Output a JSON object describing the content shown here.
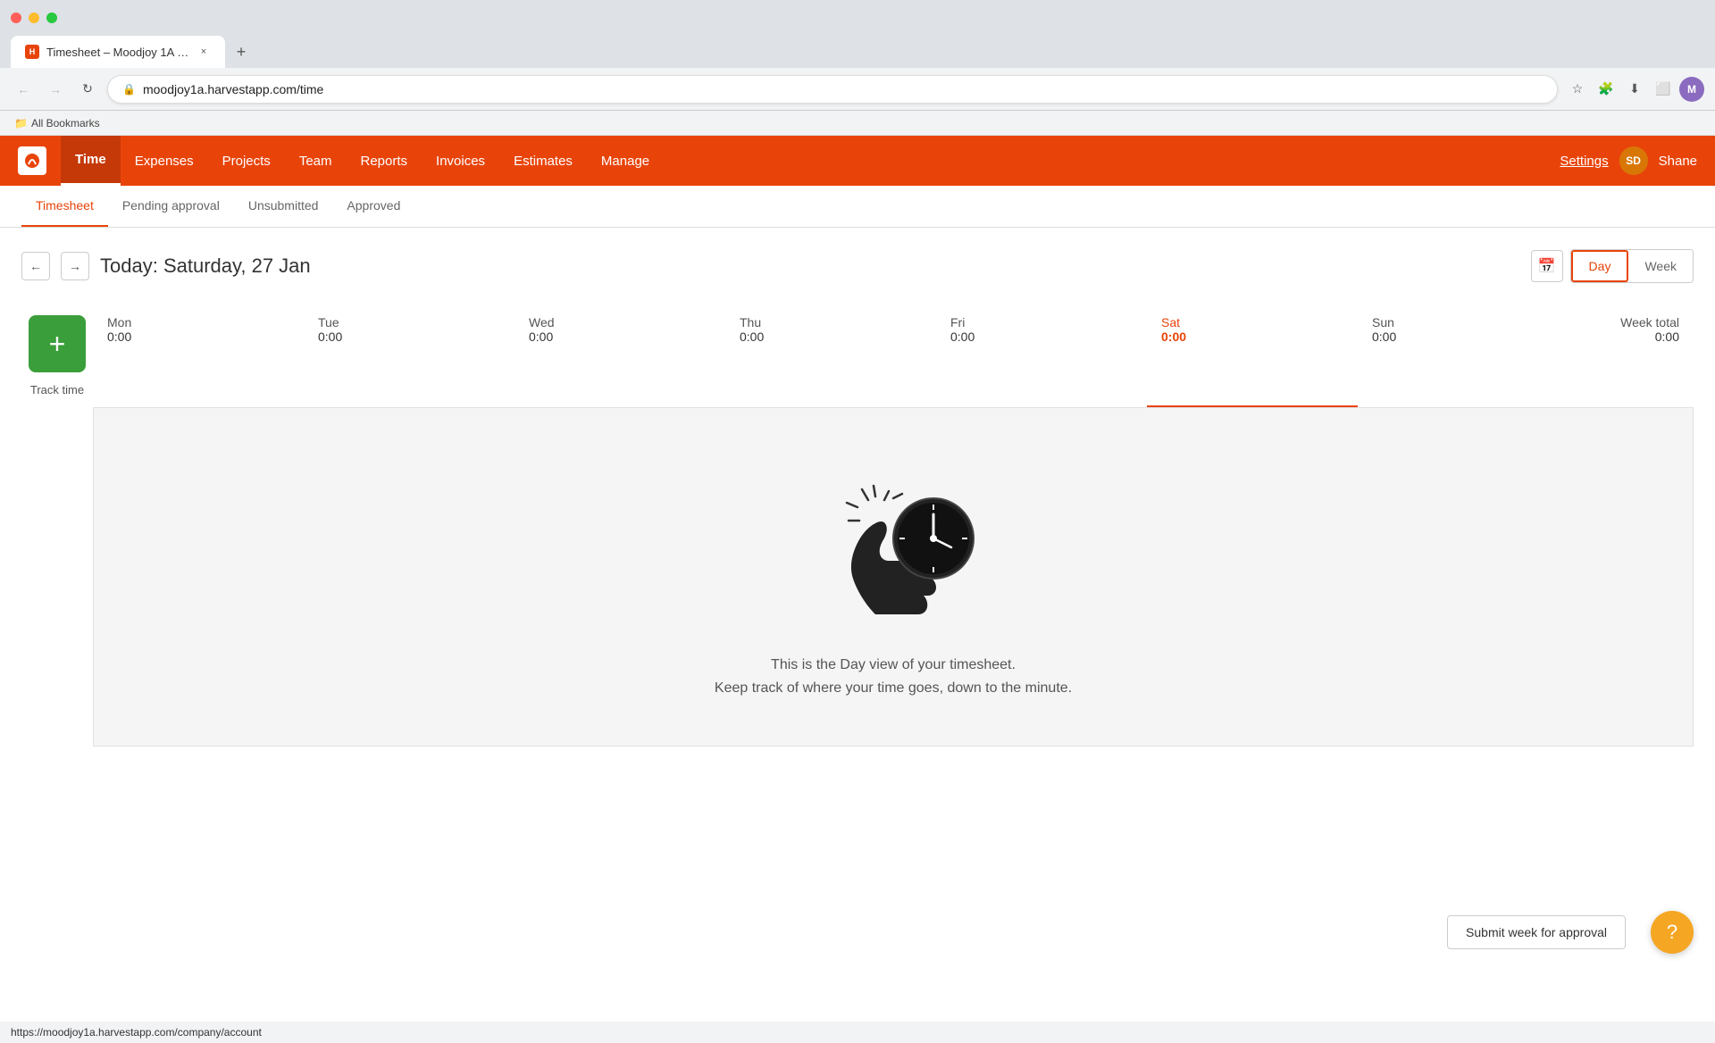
{
  "browser": {
    "tab": {
      "favicon": "H",
      "title": "Timesheet – Moodjoy 1A – Ha…",
      "close_label": "×"
    },
    "new_tab_label": "+",
    "toolbar": {
      "back_label": "←",
      "forward_label": "→",
      "refresh_label": "↻",
      "url": "moodjoy1a.harvestapp.com/time",
      "bookmark_label": "☆",
      "extensions_label": "🧩",
      "download_label": "⬇",
      "cast_label": "⬜",
      "profile_label": "M"
    },
    "bookmarks": {
      "label": "All Bookmarks"
    }
  },
  "nav": {
    "items": [
      {
        "id": "time",
        "label": "Time",
        "active": true
      },
      {
        "id": "expenses",
        "label": "Expenses"
      },
      {
        "id": "projects",
        "label": "Projects"
      },
      {
        "id": "team",
        "label": "Team"
      },
      {
        "id": "reports",
        "label": "Reports"
      },
      {
        "id": "invoices",
        "label": "Invoices"
      },
      {
        "id": "estimates",
        "label": "Estimates"
      },
      {
        "id": "manage",
        "label": "Manage"
      }
    ],
    "settings_label": "Settings",
    "user_initials": "SD",
    "user_name": "Shane"
  },
  "sub_nav": {
    "items": [
      {
        "id": "timesheet",
        "label": "Timesheet",
        "active": true
      },
      {
        "id": "pending",
        "label": "Pending approval"
      },
      {
        "id": "unsubmitted",
        "label": "Unsubmitted"
      },
      {
        "id": "approved",
        "label": "Approved"
      }
    ]
  },
  "date_nav": {
    "prev_label": "←",
    "next_label": "→",
    "today_prefix": "Today: ",
    "date": "Saturday, 27 Jan",
    "calendar_icon": "📅",
    "view_day": "Day",
    "view_week": "Week"
  },
  "week": {
    "track_time_label": "Track time",
    "plus_label": "+",
    "days": [
      {
        "name": "Mon",
        "hours": "0:00",
        "active": false
      },
      {
        "name": "Tue",
        "hours": "0:00",
        "active": false
      },
      {
        "name": "Wed",
        "hours": "0:00",
        "active": false
      },
      {
        "name": "Thu",
        "hours": "0:00",
        "active": false
      },
      {
        "name": "Fri",
        "hours": "0:00",
        "active": false
      },
      {
        "name": "Sat",
        "hours": "0:00",
        "active": true
      },
      {
        "name": "Sun",
        "hours": "0:00",
        "active": false
      }
    ],
    "total_label": "Week total",
    "total_hours": "0:00"
  },
  "empty_state": {
    "line1": "This is the Day view of your timesheet.",
    "line2": "Keep track of where your time goes, down to the minute."
  },
  "bottom": {
    "submit_label": "Submit week for approval",
    "help_label": "?"
  },
  "status_bar": {
    "url": "https://moodjoy1a.harvestapp.com/company/account"
  }
}
